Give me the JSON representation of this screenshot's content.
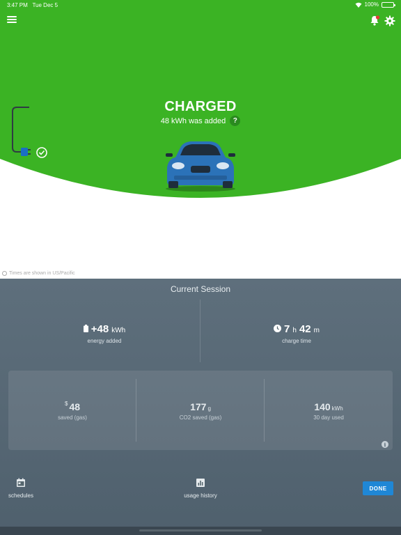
{
  "status_bar": {
    "time": "3:47 PM",
    "date": "Tue Dec 5",
    "battery": "100%"
  },
  "hero": {
    "title": "CHARGED",
    "subtitle": "48 kWh was added",
    "help_label": "?",
    "timezone_note": "Times are shown in US/Pacific"
  },
  "session": {
    "title": "Current Session",
    "energy": {
      "value": "+48",
      "unit": "kWh",
      "label": "energy added"
    },
    "charge_time": {
      "hours": "7",
      "h_unit": "h",
      "minutes": "42",
      "m_unit": "m",
      "label": "charge time"
    }
  },
  "savings": {
    "money": {
      "currency": "$",
      "value": "48",
      "label": "saved (gas)"
    },
    "co2": {
      "value": "177",
      "unit": "g",
      "label": "CO2 saved (gas)"
    },
    "usage": {
      "value": "140",
      "unit": "kWh",
      "label": "30 day used"
    },
    "info_label": "i"
  },
  "actions": {
    "schedules": "schedules",
    "usage_history": "usage history",
    "done": "DONE"
  },
  "colors": {
    "green": "#3bb324",
    "panel": "#566773",
    "done": "#1f87d6"
  }
}
